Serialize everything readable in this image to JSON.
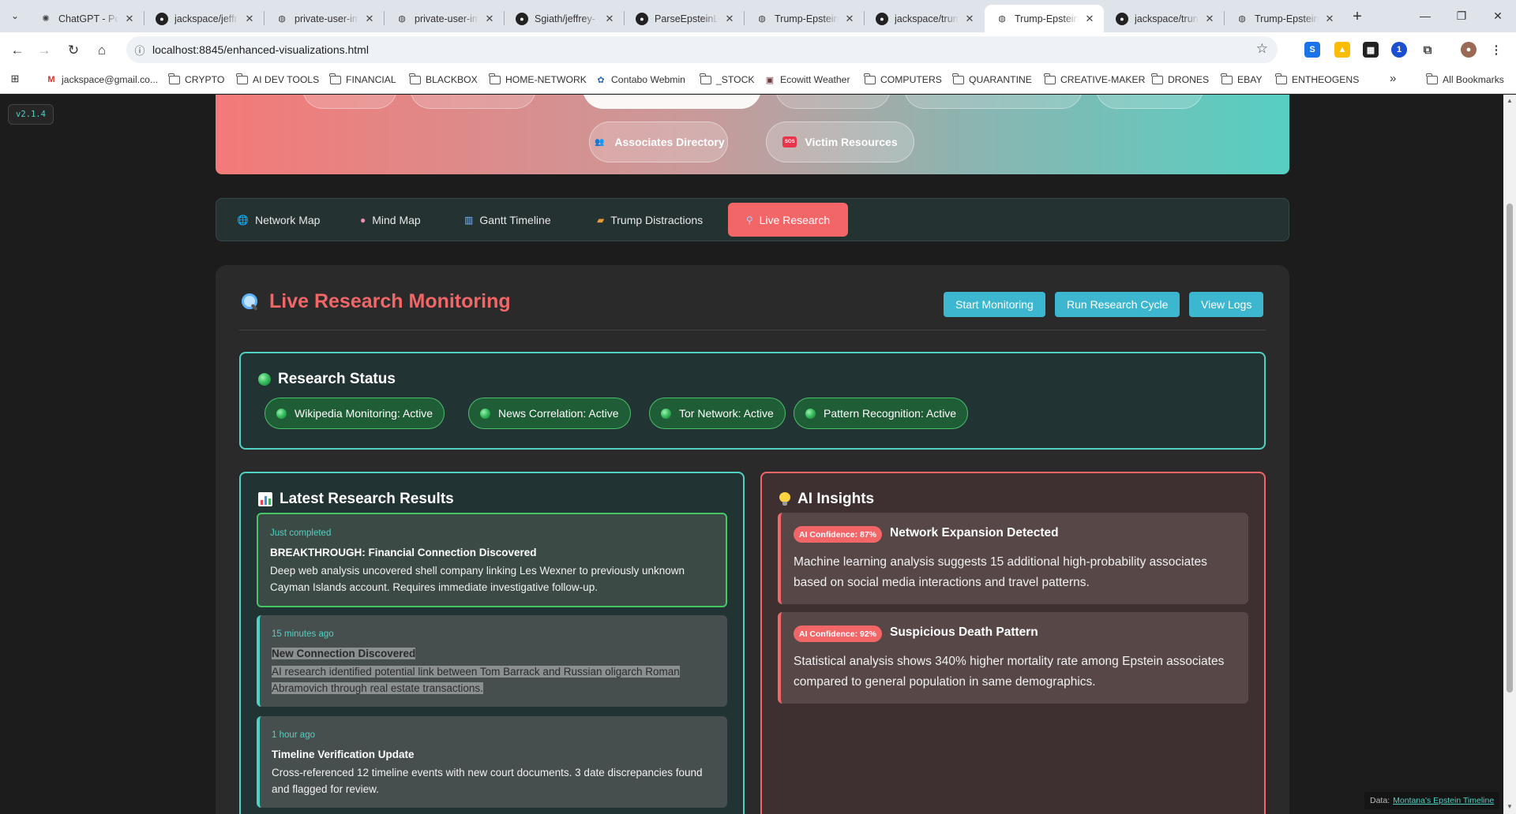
{
  "browser": {
    "tabs": [
      {
        "title": "ChatGPT - Polit",
        "icon": "chatgpt-icon"
      },
      {
        "title": "jackspace/jeffr",
        "icon": "github-icon"
      },
      {
        "title": "private-user-im",
        "icon": "globe-icon"
      },
      {
        "title": "private-user-im",
        "icon": "globe-icon"
      },
      {
        "title": "Sgiath/jeffrey-",
        "icon": "github-icon"
      },
      {
        "title": "ParseEpsteinLo",
        "icon": "github-icon"
      },
      {
        "title": "Trump-Epstein",
        "icon": "globe-icon"
      },
      {
        "title": "jackspace/trum",
        "icon": "github-icon"
      },
      {
        "title": "Trump-Epstein",
        "icon": "globe-icon"
      },
      {
        "title": "jackspace/trun",
        "icon": "github-icon"
      },
      {
        "title": "Trump-Epstein",
        "icon": "globe-icon"
      }
    ],
    "url": "localhost:8845/enhanced-visualizations.html",
    "bookmarks": [
      {
        "label": "jackspace@gmail.co...",
        "type": "gmail"
      },
      {
        "label": "CRYPTO",
        "type": "folder"
      },
      {
        "label": "AI DEV TOOLS",
        "type": "folder"
      },
      {
        "label": "FINANCIAL",
        "type": "folder"
      },
      {
        "label": "BLACKBOX",
        "type": "folder"
      },
      {
        "label": "HOME-NETWORK",
        "type": "folder"
      },
      {
        "label": "Contabo Webmin",
        "type": "site"
      },
      {
        "label": "_STOCK",
        "type": "folder"
      },
      {
        "label": "Ecowitt Weather",
        "type": "site"
      },
      {
        "label": "COMPUTERS",
        "type": "folder"
      },
      {
        "label": "QUARANTINE",
        "type": "folder"
      },
      {
        "label": "CREATIVE-MAKER",
        "type": "folder"
      },
      {
        "label": "DRONES",
        "type": "folder"
      },
      {
        "label": "EBAY",
        "type": "folder"
      },
      {
        "label": "ENTHEOGENS",
        "type": "folder"
      }
    ],
    "all_bookmarks_label": "All Bookmarks",
    "more_bookmarks_glyph": "»"
  },
  "page": {
    "version": "v2.1.4",
    "hero_buttons": [
      {
        "label": "Associates Directory",
        "icon": "people-icon"
      },
      {
        "label": "Victim Resources",
        "icon": "sos-icon"
      }
    ],
    "viz_tabs": [
      {
        "label": "Network Map",
        "icon": "globe-icon"
      },
      {
        "label": "Mind Map",
        "icon": "brain-icon"
      },
      {
        "label": "Gantt Timeline",
        "icon": "chart-icon"
      },
      {
        "label": "Trump Distractions",
        "icon": "truck-icon"
      },
      {
        "label": "Live Research",
        "icon": "magnifier-icon",
        "active": true
      }
    ],
    "research": {
      "title": "Live Research Monitoring",
      "actions": [
        "Start Monitoring",
        "Run Research Cycle",
        "View Logs"
      ],
      "status": {
        "title": "Research Status",
        "items": [
          "Wikipedia Monitoring: Active",
          "News Correlation: Active",
          "Tor Network: Active",
          "Pattern Recognition: Active"
        ]
      },
      "results": {
        "title": "Latest Research Results",
        "items": [
          {
            "time": "Just completed",
            "title": "BREAKTHROUGH: Financial Connection Discovered",
            "body": "Deep web analysis uncovered shell company linking Les Wexner to previously unknown Cayman Islands account. Requires immediate investigative follow-up."
          },
          {
            "time": "15 minutes ago",
            "title": "New Connection Discovered",
            "body_lines": [
              "AI research identified potential link between Tom Barrack and Russian oligarch Roman",
              "Abramovich through real estate transactions."
            ]
          },
          {
            "time": "1 hour ago",
            "title": "Timeline Verification Update",
            "body": "Cross-referenced 12 timeline events with new court documents. 3 date discrepancies found and flagged for review."
          }
        ]
      },
      "insights": {
        "title": "AI Insights",
        "items": [
          {
            "confidence": "AI Confidence: 87%",
            "title": "Network Expansion Detected",
            "body": "Machine learning analysis suggests 15 additional high-probability associates based on social media interactions and travel patterns."
          },
          {
            "confidence": "AI Confidence: 92%",
            "title": "Suspicious Death Pattern",
            "body": "Statistical analysis shows 340% higher mortality rate among Epstein associates compared to general population in same demographics."
          }
        ]
      }
    },
    "credit": {
      "prefix": "Data:",
      "link": "Montana's Epstein Timeline"
    }
  },
  "colors": {
    "accent_red": "#f26667",
    "accent_teal": "#4fd2c4",
    "button_blue": "#3cb7cf",
    "status_green": "#46c765"
  }
}
